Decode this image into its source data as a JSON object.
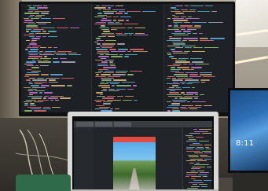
{
  "scene": {
    "description_kind": "photo",
    "right_monitor": {
      "clock_text": "8:11"
    }
  }
}
